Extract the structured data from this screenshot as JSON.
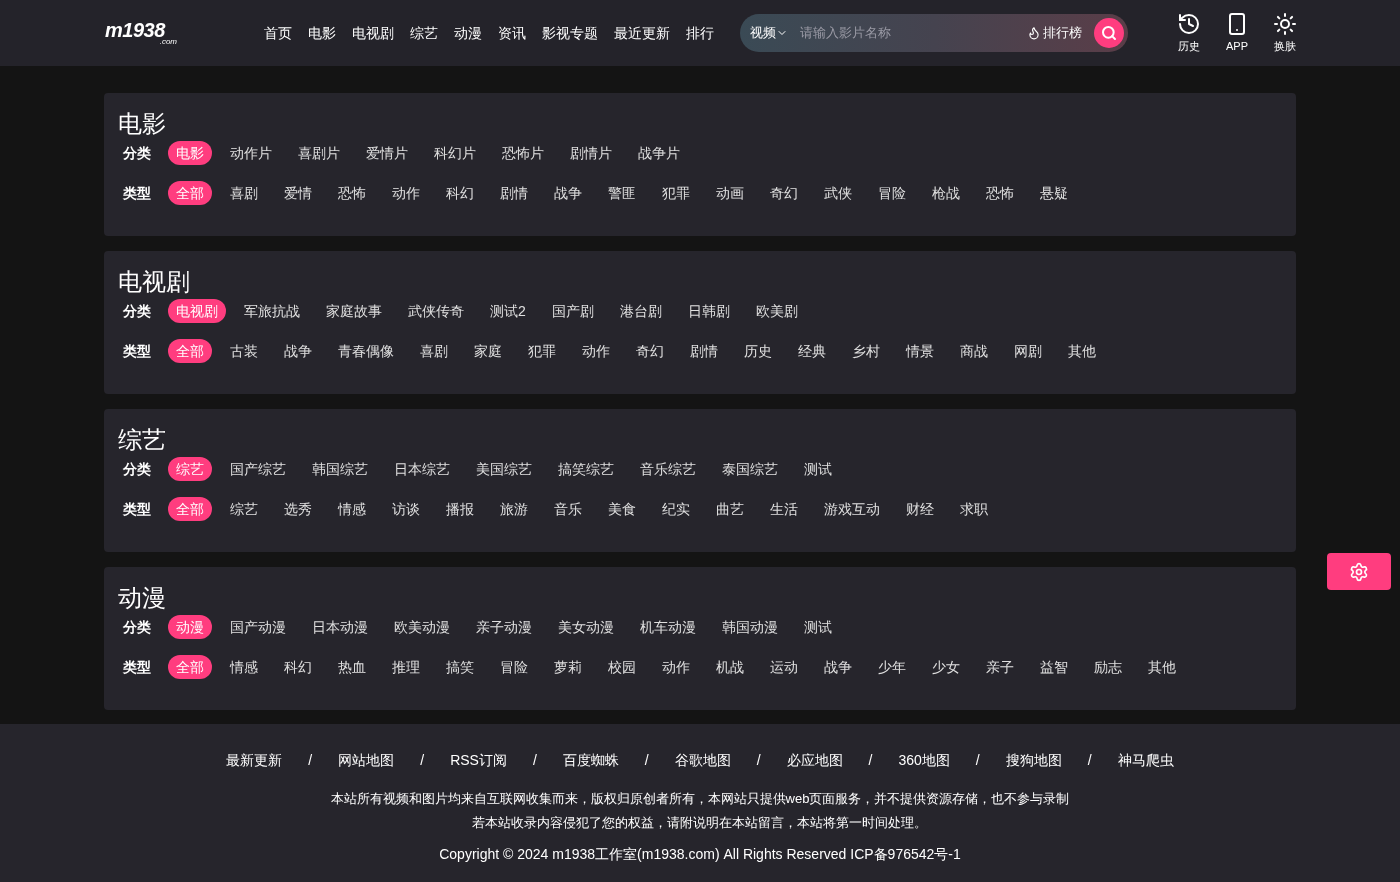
{
  "header": {
    "logo": "m1938",
    "logo_sub": ".com",
    "nav": [
      {
        "label": "首页"
      },
      {
        "label": "电影"
      },
      {
        "label": "电视剧"
      },
      {
        "label": "综艺"
      },
      {
        "label": "动漫"
      },
      {
        "label": "资讯"
      },
      {
        "label": "影视专题"
      },
      {
        "label": "最近更新"
      },
      {
        "label": "排行"
      }
    ],
    "search": {
      "scope": "视频",
      "placeholder": "请输入影片名称",
      "rank_link": "排行榜"
    },
    "tools": [
      {
        "kind": "history",
        "label": "历史"
      },
      {
        "kind": "app",
        "label": "APP"
      },
      {
        "kind": "skin",
        "label": "换肤"
      }
    ]
  },
  "sections": [
    {
      "title": "电影",
      "rows": [
        {
          "label": "分类",
          "items": [
            {
              "label": "电影",
              "selected": true
            },
            {
              "label": "动作片",
              "selected": false
            },
            {
              "label": "喜剧片",
              "selected": false
            },
            {
              "label": "爱情片",
              "selected": false
            },
            {
              "label": "科幻片",
              "selected": false
            },
            {
              "label": "恐怖片",
              "selected": false
            },
            {
              "label": "剧情片",
              "selected": false
            },
            {
              "label": "战争片",
              "selected": false
            }
          ]
        },
        {
          "label": "类型",
          "items": [
            {
              "label": "全部",
              "selected": true
            },
            {
              "label": "喜剧",
              "selected": false
            },
            {
              "label": "爱情",
              "selected": false
            },
            {
              "label": "恐怖",
              "selected": false
            },
            {
              "label": "动作",
              "selected": false
            },
            {
              "label": "科幻",
              "selected": false
            },
            {
              "label": "剧情",
              "selected": false
            },
            {
              "label": "战争",
              "selected": false
            },
            {
              "label": "警匪",
              "selected": false
            },
            {
              "label": "犯罪",
              "selected": false
            },
            {
              "label": "动画",
              "selected": false
            },
            {
              "label": "奇幻",
              "selected": false
            },
            {
              "label": "武侠",
              "selected": false
            },
            {
              "label": "冒险",
              "selected": false
            },
            {
              "label": "枪战",
              "selected": false
            },
            {
              "label": "恐怖",
              "selected": false
            },
            {
              "label": "悬疑",
              "selected": false
            }
          ]
        }
      ]
    },
    {
      "title": "电视剧",
      "rows": [
        {
          "label": "分类",
          "items": [
            {
              "label": "电视剧",
              "selected": true
            },
            {
              "label": "军旅抗战",
              "selected": false
            },
            {
              "label": "家庭故事",
              "selected": false
            },
            {
              "label": "武侠传奇",
              "selected": false
            },
            {
              "label": "测试2",
              "selected": false
            },
            {
              "label": "国产剧",
              "selected": false
            },
            {
              "label": "港台剧",
              "selected": false
            },
            {
              "label": "日韩剧",
              "selected": false
            },
            {
              "label": "欧美剧",
              "selected": false
            }
          ]
        },
        {
          "label": "类型",
          "items": [
            {
              "label": "全部",
              "selected": true
            },
            {
              "label": "古装",
              "selected": false
            },
            {
              "label": "战争",
              "selected": false
            },
            {
              "label": "青春偶像",
              "selected": false
            },
            {
              "label": "喜剧",
              "selected": false
            },
            {
              "label": "家庭",
              "selected": false
            },
            {
              "label": "犯罪",
              "selected": false
            },
            {
              "label": "动作",
              "selected": false
            },
            {
              "label": "奇幻",
              "selected": false
            },
            {
              "label": "剧情",
              "selected": false
            },
            {
              "label": "历史",
              "selected": false
            },
            {
              "label": "经典",
              "selected": false
            },
            {
              "label": "乡村",
              "selected": false
            },
            {
              "label": "情景",
              "selected": false
            },
            {
              "label": "商战",
              "selected": false
            },
            {
              "label": "网剧",
              "selected": false
            },
            {
              "label": "其他",
              "selected": false
            }
          ]
        }
      ]
    },
    {
      "title": "综艺",
      "rows": [
        {
          "label": "分类",
          "items": [
            {
              "label": "综艺",
              "selected": true
            },
            {
              "label": "国产综艺",
              "selected": false
            },
            {
              "label": "韩国综艺",
              "selected": false
            },
            {
              "label": "日本综艺",
              "selected": false
            },
            {
              "label": "美国综艺",
              "selected": false
            },
            {
              "label": "搞笑综艺",
              "selected": false
            },
            {
              "label": "音乐综艺",
              "selected": false
            },
            {
              "label": "泰国综艺",
              "selected": false
            },
            {
              "label": "测试",
              "selected": false
            }
          ]
        },
        {
          "label": "类型",
          "items": [
            {
              "label": "全部",
              "selected": true
            },
            {
              "label": "综艺",
              "selected": false
            },
            {
              "label": "选秀",
              "selected": false
            },
            {
              "label": "情感",
              "selected": false
            },
            {
              "label": "访谈",
              "selected": false
            },
            {
              "label": "播报",
              "selected": false
            },
            {
              "label": "旅游",
              "selected": false
            },
            {
              "label": "音乐",
              "selected": false
            },
            {
              "label": "美食",
              "selected": false
            },
            {
              "label": "纪实",
              "selected": false
            },
            {
              "label": "曲艺",
              "selected": false
            },
            {
              "label": "生活",
              "selected": false
            },
            {
              "label": "游戏互动",
              "selected": false
            },
            {
              "label": "财经",
              "selected": false
            },
            {
              "label": "求职",
              "selected": false
            }
          ]
        }
      ]
    },
    {
      "title": "动漫",
      "rows": [
        {
          "label": "分类",
          "items": [
            {
              "label": "动漫",
              "selected": true
            },
            {
              "label": "国产动漫",
              "selected": false
            },
            {
              "label": "日本动漫",
              "selected": false
            },
            {
              "label": "欧美动漫",
              "selected": false
            },
            {
              "label": "亲子动漫",
              "selected": false
            },
            {
              "label": "美女动漫",
              "selected": false
            },
            {
              "label": "机车动漫",
              "selected": false
            },
            {
              "label": "韩国动漫",
              "selected": false
            },
            {
              "label": "测试",
              "selected": false
            }
          ]
        },
        {
          "label": "类型",
          "items": [
            {
              "label": "全部",
              "selected": true
            },
            {
              "label": "情感",
              "selected": false
            },
            {
              "label": "科幻",
              "selected": false
            },
            {
              "label": "热血",
              "selected": false
            },
            {
              "label": "推理",
              "selected": false
            },
            {
              "label": "搞笑",
              "selected": false
            },
            {
              "label": "冒险",
              "selected": false
            },
            {
              "label": "萝莉",
              "selected": false
            },
            {
              "label": "校园",
              "selected": false
            },
            {
              "label": "动作",
              "selected": false
            },
            {
              "label": "机战",
              "selected": false
            },
            {
              "label": "运动",
              "selected": false
            },
            {
              "label": "战争",
              "selected": false
            },
            {
              "label": "少年",
              "selected": false
            },
            {
              "label": "少女",
              "selected": false
            },
            {
              "label": "亲子",
              "selected": false
            },
            {
              "label": "益智",
              "selected": false
            },
            {
              "label": "励志",
              "selected": false
            },
            {
              "label": "其他",
              "selected": false
            }
          ]
        }
      ]
    }
  ],
  "footer": {
    "links": [
      {
        "label": "最新更新",
        "separator": "/"
      },
      {
        "label": "网站地图",
        "separator": "/"
      },
      {
        "label": "RSS订阅",
        "separator": "/"
      },
      {
        "label": "百度蜘蛛",
        "separator": "/"
      },
      {
        "label": "谷歌地图",
        "separator": "/"
      },
      {
        "label": "必应地图",
        "separator": "/"
      },
      {
        "label": "360地图",
        "separator": "/"
      },
      {
        "label": "搜狗地图",
        "separator": "/"
      },
      {
        "label": "神马爬虫"
      }
    ],
    "notice": [
      "本站所有视频和图片均来自互联网收集而来，版权归原创者所有，本网站只提供web页面服务，并不提供资源存储，也不参与录制",
      "若本站收录内容侵犯了您的权益，请附说明在本站留言，本站将第一时间处理。"
    ],
    "copyright": "Copyright © 2024 m1938工作室(m1938.com) All Rights Reserved ICP备976542号-1"
  }
}
